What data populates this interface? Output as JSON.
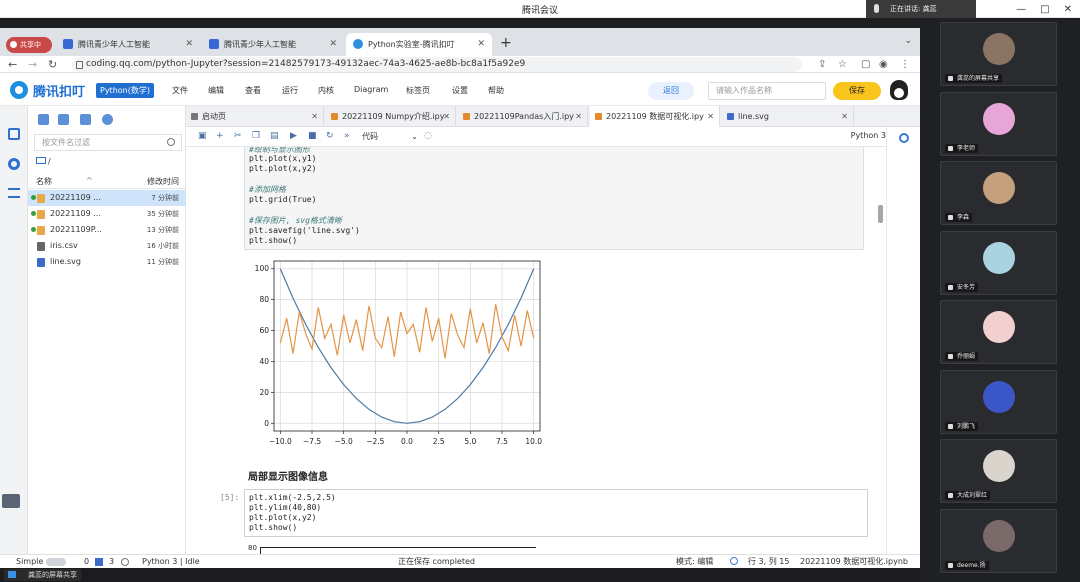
{
  "meeting": {
    "title": "腾讯会议",
    "speaking": "正在讲话: 龚蕊",
    "window_controls": [
      "—",
      "□",
      "✕"
    ]
  },
  "browser": {
    "shared_badge": "共享中",
    "tabs": [
      {
        "label": "腾讯青少年人工智能",
        "active": false
      },
      {
        "label": "腾讯青少年人工智能",
        "active": false
      },
      {
        "label": "Python实验室-腾讯扣叮",
        "active": true
      }
    ],
    "new_tab": "+",
    "tab_menu": "⌄",
    "url": "coding.qq.com/python-Jupyter?session=21482579173-49132aec-74a3-4625-ae8b-bc8a1f5a92e9"
  },
  "app": {
    "logo": "腾讯扣叮",
    "lang_badge": "Python(数学)",
    "menus": [
      "文件",
      "编辑",
      "查看",
      "运行",
      "内核",
      "Diagram",
      "标签页",
      "设置",
      "帮助"
    ],
    "back": "返回",
    "work_name_placeholder": "请输入作品名称",
    "save": "保存"
  },
  "files": {
    "filter_placeholder": "按文件名过滤",
    "folder": "/",
    "col_name": "名称",
    "col_time": "修改时间",
    "sort": "^",
    "rows": [
      {
        "name": "20221109 ...",
        "time": "7 分钟前",
        "running": true,
        "type": "nb",
        "selected": true
      },
      {
        "name": "20221109 ...",
        "time": "35 分钟前",
        "running": true,
        "type": "nb",
        "selected": false
      },
      {
        "name": "20221109P...",
        "time": "13 分钟前",
        "running": true,
        "type": "nb",
        "selected": false
      },
      {
        "name": "iris.csv",
        "time": "16 小时前",
        "running": false,
        "type": "csv",
        "selected": false
      },
      {
        "name": "line.svg",
        "time": "11 分钟前",
        "running": false,
        "type": "svg",
        "selected": false
      }
    ]
  },
  "notebook_tabs": [
    {
      "label": "启动页",
      "active": false
    },
    {
      "label": "20221109 Numpy介绍.ipy",
      "active": false
    },
    {
      "label": "20221109Pandas入门.ipy",
      "active": false
    },
    {
      "label": "20221109 数据可视化.ipy",
      "active": true
    },
    {
      "label": "line.svg",
      "active": false
    }
  ],
  "toolbar": {
    "cell_type": "代码",
    "kernel": "Python 3"
  },
  "cell1": {
    "lines": [
      {
        "t": "#绘制与显示图形",
        "c": "cm"
      },
      {
        "t": "plt.plot(x,y1)",
        "c": ""
      },
      {
        "t": "plt.plot(x,y2)",
        "c": ""
      },
      {
        "t": "",
        "c": ""
      },
      {
        "t": "#添加网格",
        "c": "cm"
      },
      {
        "t": "plt.grid(True)",
        "c": ""
      },
      {
        "t": "",
        "c": ""
      },
      {
        "t": "#保存图片, svg格式清晰",
        "c": "cm"
      },
      {
        "t": "plt.savefig('line.svg')",
        "c": ""
      },
      {
        "t": "plt.show()",
        "c": ""
      }
    ]
  },
  "chart_data": {
    "type": "line",
    "xlim": [
      -10.5,
      10.5
    ],
    "ylim": [
      -5,
      105
    ],
    "xticks": [
      "−10.0",
      "−7.5",
      "−5.0",
      "−2.5",
      "0.0",
      "2.5",
      "5.0",
      "7.5",
      "10.0"
    ],
    "xtick_values": [
      -10,
      -7.5,
      -5,
      -2.5,
      0,
      2.5,
      5,
      7.5,
      10
    ],
    "yticks": [
      "0",
      "20",
      "40",
      "60",
      "80",
      "100"
    ],
    "ytick_values": [
      0,
      20,
      40,
      60,
      80,
      100
    ],
    "grid": true,
    "series": [
      {
        "color": "#4a7aa7",
        "x": [
          -10,
          -9,
          -8,
          -7,
          -6,
          -5,
          -4,
          -3,
          -2,
          -1,
          0,
          1,
          2,
          3,
          4,
          5,
          6,
          7,
          8,
          9,
          10
        ],
        "values": [
          100,
          81,
          64,
          49,
          36,
          25,
          16,
          9,
          4,
          1,
          0,
          1,
          4,
          9,
          16,
          25,
          36,
          49,
          64,
          81,
          100
        ]
      },
      {
        "color": "#e39445",
        "x": [
          -10,
          -9.5,
          -9,
          -8.5,
          -8,
          -7.5,
          -7,
          -6.5,
          -6,
          -5.5,
          -5,
          -4.5,
          -4,
          -3.5,
          -3,
          -2.5,
          -2,
          -1.5,
          -1,
          -0.5,
          0,
          0.5,
          1,
          1.5,
          2,
          2.5,
          3,
          3.5,
          4,
          4.5,
          5,
          5.5,
          6,
          6.5,
          7,
          7.5,
          8,
          8.5,
          9,
          9.5,
          10
        ],
        "values": [
          52,
          68,
          45,
          72,
          58,
          48,
          75,
          55,
          64,
          44,
          70,
          52,
          67,
          47,
          76,
          55,
          49,
          69,
          43,
          72,
          58,
          64,
          46,
          75,
          53,
          68,
          42,
          71,
          57,
          49,
          74,
          52,
          65,
          45,
          77,
          56,
          47,
          70,
          50,
          73,
          55
        ]
      }
    ]
  },
  "section_heading": "局部显示图像信息",
  "cell2": {
    "prompt": "[5]:",
    "lines": [
      "plt.xlim(-2.5,2.5)",
      "plt.ylim(40,80)",
      "plt.plot(x,y2)",
      "plt.show()"
    ]
  },
  "stub_label": "80",
  "status": {
    "mode": "Simple",
    "count0": "0",
    "count3": "3",
    "kernel_state": "Python 3 | Idle",
    "saving": "正在保存 completed",
    "edit_mode": "模式: 编辑",
    "cursor": "行 3, 列 15",
    "filename": "20221109 数据可视化.ipynb"
  },
  "share": {
    "label": "龚蕊的屏幕共享"
  },
  "participants": [
    {
      "name": "龚蕊的屏幕共享",
      "color": "#8a7565"
    },
    {
      "name": "李老师",
      "color": "#e6a7d8"
    },
    {
      "name": "李森",
      "color": "#c4a07c"
    },
    {
      "name": "安冬芳",
      "color": "#a9d3e0"
    },
    {
      "name": "乔丽娟",
      "color": "#f2d0d0"
    },
    {
      "name": "刘鹏飞",
      "color": "#3a56c7"
    },
    {
      "name": "大成刘翠红",
      "color": "#d9d4cc"
    },
    {
      "name": "deeme.扬",
      "color": "#7b6a6a"
    }
  ]
}
